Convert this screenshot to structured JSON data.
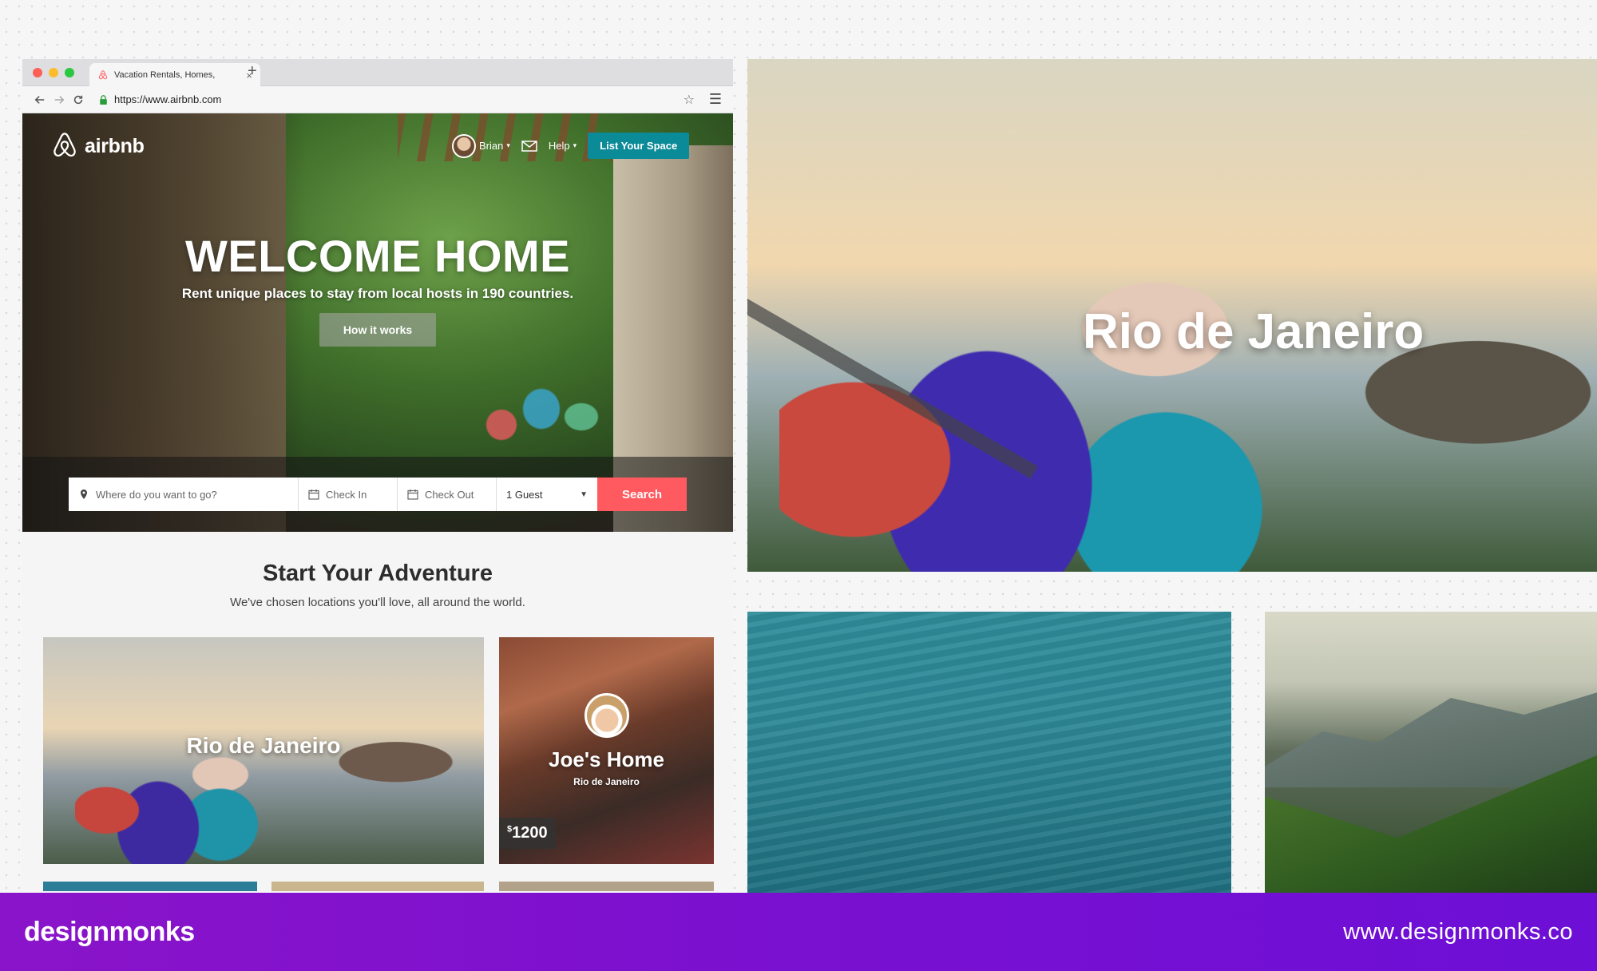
{
  "browser": {
    "tab_title": "Vacation Rentals, Homes,",
    "tab_close": "×",
    "new_tab": "+",
    "url": "https://www.airbnb.com"
  },
  "header": {
    "logo_text": "airbnb",
    "user_name": "Brian",
    "help_label": "Help",
    "list_space_label": "List Your Space"
  },
  "hero": {
    "title": "WELCOME HOME",
    "subtitle": "Rent unique places to stay from local hosts in 190 countries.",
    "how_it_works_label": "How it works"
  },
  "search": {
    "where_placeholder": "Where do you want to go?",
    "check_in_label": "Check In",
    "check_out_label": "Check Out",
    "guests_value": "1 Guest",
    "search_label": "Search"
  },
  "adventure": {
    "title": "Start Your Adventure",
    "subtitle": "We've chosen locations you'll love, all around the world.",
    "cards": [
      {
        "label": "Rio de Janeiro"
      },
      {
        "label": "Joe's Home",
        "sublabel": "Rio de Janeiro",
        "currency": "$",
        "price": "1200"
      }
    ]
  },
  "showcase": {
    "large_label": "Rio de Janeiro"
  },
  "footer": {
    "brand": "designmonks",
    "site": "www.designmonks.co"
  },
  "colors": {
    "airbnb_red": "#ff5a5f",
    "teal_button": "#0b8a98",
    "footer_purple": "#7a10d0"
  }
}
